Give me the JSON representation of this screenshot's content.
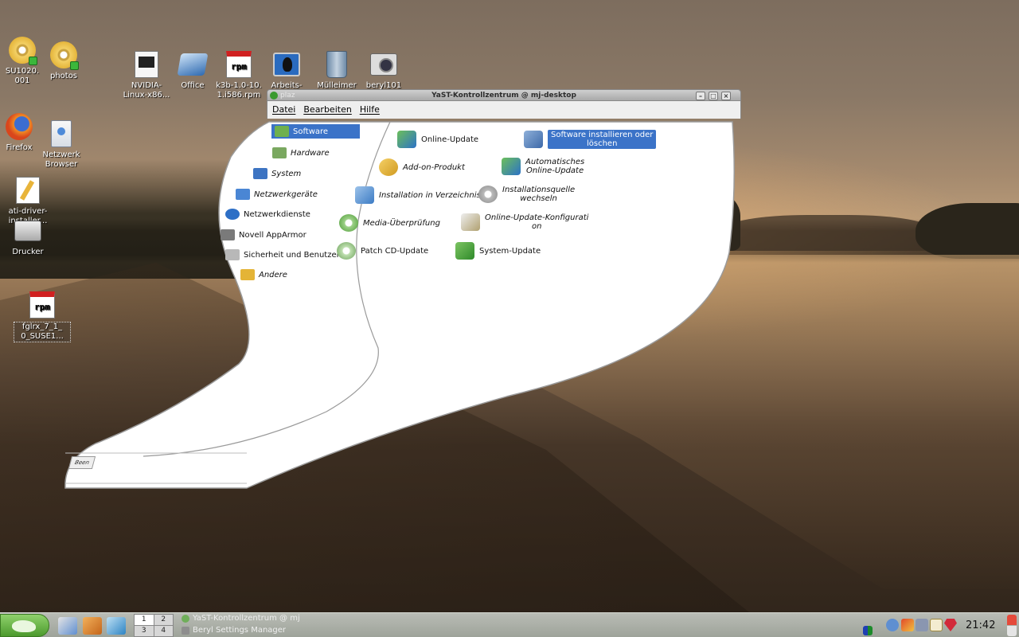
{
  "desktop": {
    "icons": [
      {
        "label": "SU1020.\n001"
      },
      {
        "label": "photos"
      },
      {
        "label": "NVIDIA-\nLinux-x86..."
      },
      {
        "label": "Office"
      },
      {
        "label": "k3b-1.0-10.\n1.i586.rpm"
      },
      {
        "label": "Arbeits-"
      },
      {
        "label": "Mülleimer"
      },
      {
        "label": "beryl101\npng"
      },
      {
        "label": "Firefox"
      },
      {
        "label": "Netzwerk\nBrowser"
      },
      {
        "label": "ati-driver-\ninstaller..."
      },
      {
        "label": "Drucker"
      },
      {
        "label": "fglrx_7_1_\n0_SUSE1..."
      }
    ]
  },
  "yast": {
    "title": "YaST-Kontrollzentrum @ mj-desktop",
    "tab_fragment": "plaz",
    "menu": [
      "Datei",
      "Bearbeiten",
      "Hilfe"
    ],
    "categories": [
      {
        "label": "Software"
      },
      {
        "label": "Hardware"
      },
      {
        "label": "System"
      },
      {
        "label": "Netzwerkgeräte"
      },
      {
        "label": "Netzwerkdienste"
      },
      {
        "label": "Novell AppArmor"
      },
      {
        "label": "Sicherheit und Benutzer"
      },
      {
        "label": "Andere"
      }
    ],
    "modules": [
      {
        "label": "Online-Update"
      },
      {
        "label": "Software installieren oder\nlöschen"
      },
      {
        "label": "Add-on-Produkt"
      },
      {
        "label": "Automatisches\nOnline-Update"
      },
      {
        "label": "Installation in Verzeichnis"
      },
      {
        "label": "Installationsquelle\nwechseln"
      },
      {
        "label": "Media-Überprüfung"
      },
      {
        "label": "Online-Update-Konfigurati\non"
      },
      {
        "label": "Patch CD-Update"
      },
      {
        "label": "System-Update"
      }
    ],
    "bottom_button": "Been"
  },
  "taskbar": {
    "pager": [
      "1",
      "2",
      "3",
      "4"
    ],
    "tasks": [
      {
        "label": "YaST-Kontrollzentrum @ mj"
      },
      {
        "label": "Beryl Settings Manager"
      }
    ],
    "clock": "21:42"
  },
  "colors": {
    "selection": "#3b73c8",
    "taskbar": "#a9ada5",
    "start_green": "#5fae3c"
  }
}
